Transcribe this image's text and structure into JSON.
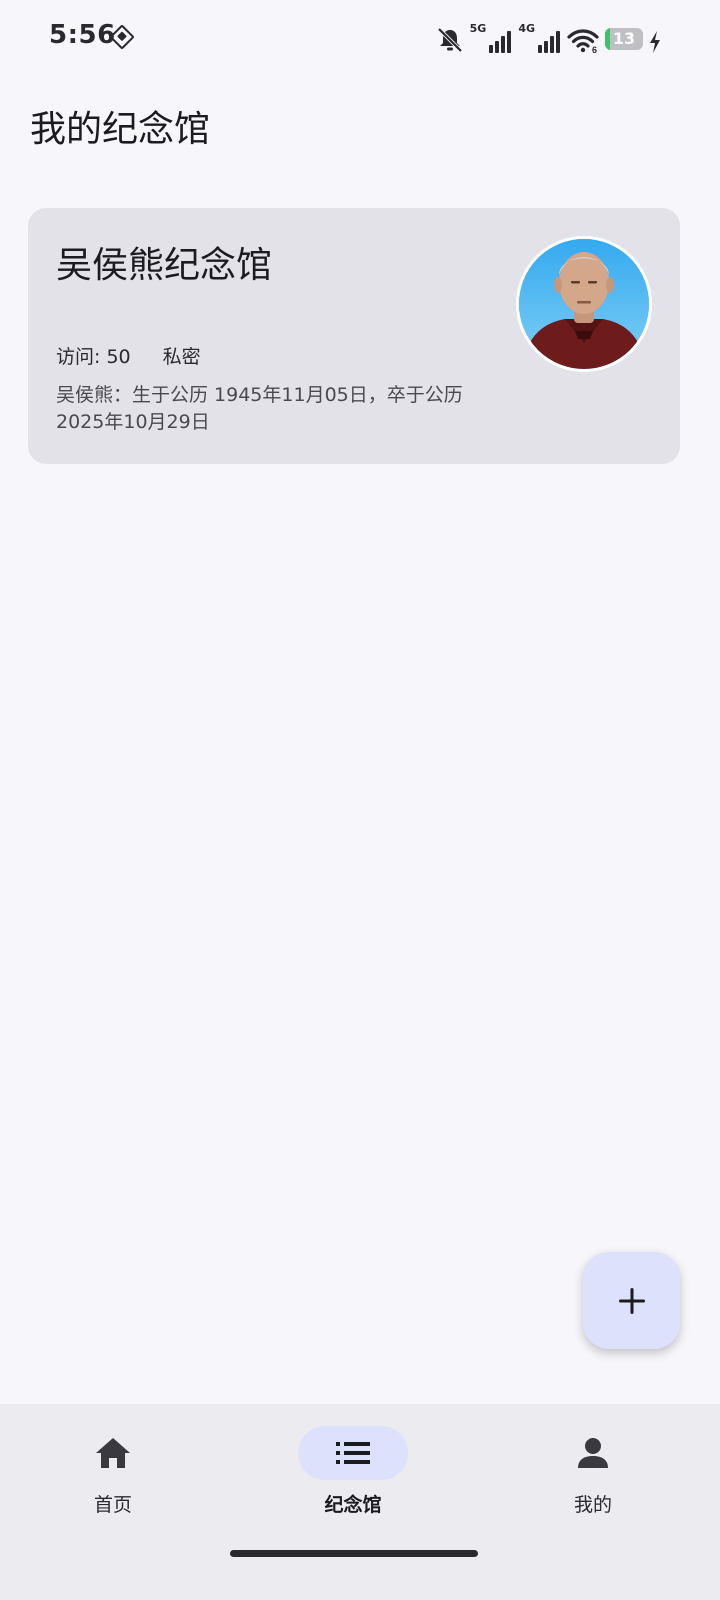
{
  "status_bar": {
    "time": "5:56",
    "network_5g_label": "5G",
    "network_4g_label": "4G",
    "wifi_label": "6",
    "battery_level": 13,
    "battery_text": "13",
    "icons": [
      "dnd-diamond-icon",
      "bell-muted-icon",
      "signal-5g-icon",
      "signal-4g-icon",
      "wifi-icon",
      "battery-icon",
      "charging-bolt-icon"
    ]
  },
  "page": {
    "title": "我的纪念馆"
  },
  "memorials": [
    {
      "name": "吴侯熊纪念馆",
      "visits_label": "访问: 50",
      "privacy": "私密",
      "description": "吴侯熊：生于公历 1945年11月05日，卒于公历 2025年10月29日",
      "avatar": "portrait-photo"
    }
  ],
  "fab": {
    "icon": "plus-icon"
  },
  "bottom_nav": {
    "items": [
      {
        "label": "首页",
        "icon": "home-icon",
        "active": false
      },
      {
        "label": "纪念馆",
        "icon": "list-icon",
        "active": true
      },
      {
        "label": "我的",
        "icon": "person-icon",
        "active": false
      }
    ]
  },
  "colors": {
    "background": "#f7f6fb",
    "card": "#e3e2e8",
    "accent_container": "#dde1fb",
    "nav_background": "#ecebf0",
    "battery_green": "#3cc26a"
  }
}
